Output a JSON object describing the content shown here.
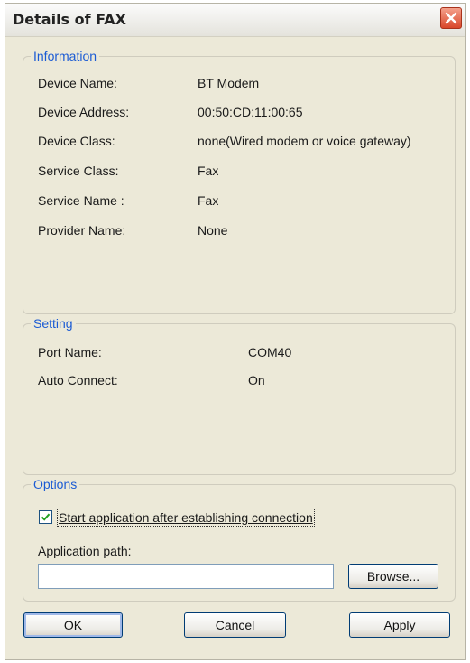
{
  "window": {
    "title": "Details of FAX"
  },
  "information": {
    "legend": "Information",
    "rows": [
      {
        "label": "Device Name:",
        "value": "BT Modem"
      },
      {
        "label": "Device Address:",
        "value": "00:50:CD:11:00:65"
      },
      {
        "label": "Device Class:",
        "value": "none(Wired modem or voice gateway)"
      },
      {
        "label": "Service Class:",
        "value": "Fax"
      },
      {
        "label": "Service Name :",
        "value": "Fax"
      },
      {
        "label": "Provider Name:",
        "value": "None"
      }
    ]
  },
  "setting": {
    "legend": "Setting",
    "rows": [
      {
        "label": "Port Name:",
        "value": "COM40"
      },
      {
        "label": "Auto Connect:",
        "value": "On"
      }
    ]
  },
  "options": {
    "legend": "Options",
    "start_app_checkbox": {
      "label": "Start application after establishing connection",
      "checked": true
    },
    "app_path_label": "Application path:",
    "app_path_value": "",
    "browse_label": "Browse..."
  },
  "buttons": {
    "ok": "OK",
    "cancel": "Cancel",
    "apply": "Apply"
  },
  "colors": {
    "legend": "#1b5bd4",
    "close": "#d9472a",
    "check": "#21a121"
  }
}
